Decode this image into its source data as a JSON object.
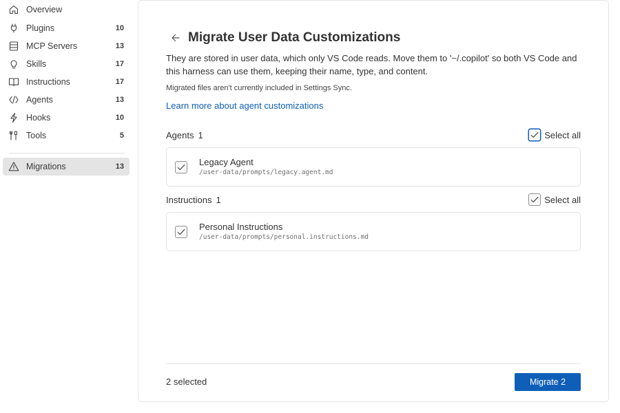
{
  "sidebar": {
    "items": [
      {
        "label": "Overview",
        "count": "",
        "icon": "home-icon"
      },
      {
        "label": "Plugins",
        "count": "10",
        "icon": "plug-icon"
      },
      {
        "label": "MCP Servers",
        "count": "13",
        "icon": "server-icon"
      },
      {
        "label": "Skills",
        "count": "17",
        "icon": "lightbulb-icon"
      },
      {
        "label": "Instructions",
        "count": "17",
        "icon": "book-icon"
      },
      {
        "label": "Agents",
        "count": "13",
        "icon": "agent-icon"
      },
      {
        "label": "Hooks",
        "count": "10",
        "icon": "lightning-icon"
      },
      {
        "label": "Tools",
        "count": "5",
        "icon": "tools-icon"
      },
      {
        "label": "Migrations",
        "count": "13",
        "icon": "warning-icon"
      }
    ],
    "active": "Migrations"
  },
  "main": {
    "title": "Migrate User Data Customizations",
    "description": "They are stored in user data, which only VS Code reads. Move them to '~/.copilot' so both VS Code and this harness can use them, keeping their name, type, and content.",
    "sync_note": "Migrated files aren't currently included in Settings Sync.",
    "learn_more": "Learn more about agent customizations",
    "sections": [
      {
        "title": "Agents",
        "count": "1",
        "select_all_label": "Select all",
        "select_all_checked": true,
        "items": [
          {
            "name": "Legacy Agent",
            "path": "/user-data/prompts/legacy.agent.md",
            "checked": true
          }
        ]
      },
      {
        "title": "Instructions",
        "count": "1",
        "select_all_label": "Select all",
        "select_all_checked": true,
        "items": [
          {
            "name": "Personal Instructions",
            "path": "/user-data/prompts/personal.instructions.md",
            "checked": true
          }
        ]
      }
    ],
    "footer": {
      "selected_text": "2 selected",
      "migrate_label": "Migrate 2"
    }
  },
  "colors": {
    "accent": "#0f5fb8",
    "active_nav_bg": "#e4e4e4",
    "border": "#e3e3e3"
  }
}
